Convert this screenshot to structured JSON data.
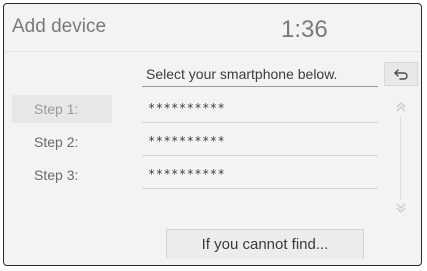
{
  "header": {
    "title": "Add device",
    "clock": "1:36"
  },
  "instruction": "Select your smartphone below.",
  "back_icon": "back-arrow-icon",
  "steps": [
    {
      "label": "Step 1:",
      "value": "**********"
    },
    {
      "label": "Step 2:",
      "value": "**********"
    },
    {
      "label": "Step 3:",
      "value": "**********"
    }
  ],
  "scroll_icons": {
    "up": "chevron-double-up-icon",
    "down": "chevron-double-down-icon"
  },
  "find_button": "If you cannot find..."
}
